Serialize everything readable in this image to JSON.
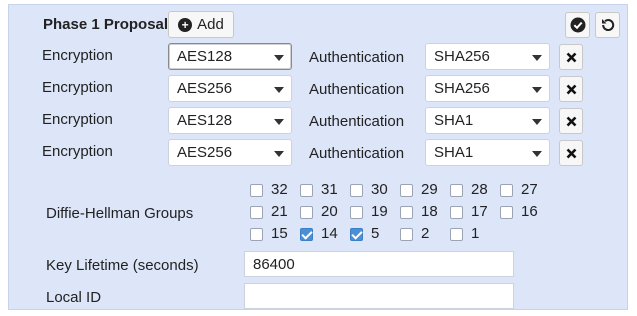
{
  "phase": {
    "title": "Phase 1 Proposal",
    "add_label": "Add",
    "add_icon": "plus-circle-icon",
    "apply_icon": "check-circle-icon",
    "reset_icon": "undo-icon"
  },
  "proposals": [
    {
      "enc_label": "Encryption",
      "enc": "AES128",
      "auth_label": "Authentication",
      "auth": "SHA256"
    },
    {
      "enc_label": "Encryption",
      "enc": "AES256",
      "auth_label": "Authentication",
      "auth": "SHA256"
    },
    {
      "enc_label": "Encryption",
      "enc": "AES128",
      "auth_label": "Authentication",
      "auth": "SHA1"
    },
    {
      "enc_label": "Encryption",
      "enc": "AES256",
      "auth_label": "Authentication",
      "auth": "SHA1"
    }
  ],
  "dh": {
    "label": "Diffie-Hellman Groups",
    "groups": [
      {
        "n": "32",
        "checked": false
      },
      {
        "n": "31",
        "checked": false
      },
      {
        "n": "30",
        "checked": false
      },
      {
        "n": "29",
        "checked": false
      },
      {
        "n": "28",
        "checked": false
      },
      {
        "n": "27",
        "checked": false
      },
      {
        "n": "21",
        "checked": false
      },
      {
        "n": "20",
        "checked": false
      },
      {
        "n": "19",
        "checked": false
      },
      {
        "n": "18",
        "checked": false
      },
      {
        "n": "17",
        "checked": false
      },
      {
        "n": "16",
        "checked": false
      },
      {
        "n": "15",
        "checked": false
      },
      {
        "n": "14",
        "checked": true
      },
      {
        "n": "5",
        "checked": true
      },
      {
        "n": "2",
        "checked": false
      },
      {
        "n": "1",
        "checked": false
      }
    ]
  },
  "key_lifetime": {
    "label": "Key Lifetime (seconds)",
    "value": "86400"
  },
  "local_id": {
    "label": "Local ID",
    "value": ""
  },
  "colors": {
    "panel_bg": "#dce6f8",
    "checkbox_checked": "#4a90d9"
  }
}
